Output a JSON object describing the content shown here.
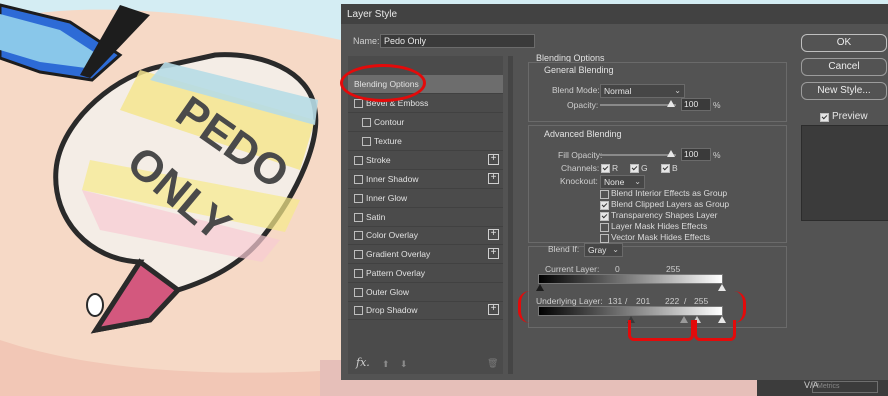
{
  "dialog": {
    "title": "Layer Style",
    "name_label": "Name:",
    "name_value": "Pedo Only"
  },
  "left_panel": {
    "items": [
      {
        "label": "Blending Options",
        "selected": true,
        "checkbox": false,
        "plus": false
      },
      {
        "label": "Bevel & Emboss",
        "selected": false,
        "checkbox": true,
        "plus": false
      },
      {
        "label": "Contour",
        "selected": false,
        "checkbox": true,
        "plus": false,
        "indent": true
      },
      {
        "label": "Texture",
        "selected": false,
        "checkbox": true,
        "plus": false,
        "indent": true
      },
      {
        "label": "Stroke",
        "selected": false,
        "checkbox": true,
        "plus": true
      },
      {
        "label": "Inner Shadow",
        "selected": false,
        "checkbox": true,
        "plus": true
      },
      {
        "label": "Inner Glow",
        "selected": false,
        "checkbox": true,
        "plus": false
      },
      {
        "label": "Satin",
        "selected": false,
        "checkbox": true,
        "plus": false
      },
      {
        "label": "Color Overlay",
        "selected": false,
        "checkbox": true,
        "plus": true
      },
      {
        "label": "Gradient Overlay",
        "selected": false,
        "checkbox": true,
        "plus": true
      },
      {
        "label": "Pattern Overlay",
        "selected": false,
        "checkbox": true,
        "plus": false
      },
      {
        "label": "Outer Glow",
        "selected": false,
        "checkbox": true,
        "plus": false
      },
      {
        "label": "Drop Shadow",
        "selected": false,
        "checkbox": true,
        "plus": true
      }
    ],
    "footer": {
      "fx_label": "fx."
    }
  },
  "blending": {
    "section_title": "Blending Options",
    "general_title": "General Blending",
    "blend_mode_label": "Blend Mode:",
    "blend_mode_value": "Normal",
    "opacity_label": "Opacity:",
    "opacity_value": "100",
    "pct": "%",
    "advanced_title": "Advanced Blending",
    "fill_opacity_label": "Fill Opacity:",
    "fill_opacity_value": "100",
    "channels_label": "Channels:",
    "channel_r": "R",
    "channel_g": "G",
    "channel_b": "B",
    "knockout_label": "Knockout:",
    "knockout_value": "None",
    "options": [
      {
        "label": "Blend Interior Effects as Group",
        "checked": false
      },
      {
        "label": "Blend Clipped Layers as Group",
        "checked": true
      },
      {
        "label": "Transparency Shapes Layer",
        "checked": true
      },
      {
        "label": "Layer Mask Hides Effects",
        "checked": false
      },
      {
        "label": "Vector Mask Hides Effects",
        "checked": false
      }
    ],
    "blend_if_label": "Blend If:",
    "blend_if_value": "Gray",
    "current_layer_label": "Current Layer:",
    "current_low": "0",
    "current_high": "255",
    "underlying_label": "Underlying Layer:",
    "underlying_low_a": "131",
    "underlying_slash1": "/",
    "underlying_low_b": "201",
    "underlying_high_a": "222",
    "underlying_slash2": "/",
    "underlying_high_b": "255"
  },
  "right_panel": {
    "ok_label": "OK",
    "cancel_label": "Cancel",
    "new_style_label": "New Style...",
    "preview_label": "Preview"
  },
  "background": {
    "sticker_text_1": "PEDO",
    "sticker_text_2": "ONLY"
  },
  "toolbar_strip": {
    "va_label": "V/A",
    "metrics_label": "Metrics"
  },
  "colors": {
    "dialog_bg": "#535353",
    "annotation_red": "#e40a0a"
  }
}
